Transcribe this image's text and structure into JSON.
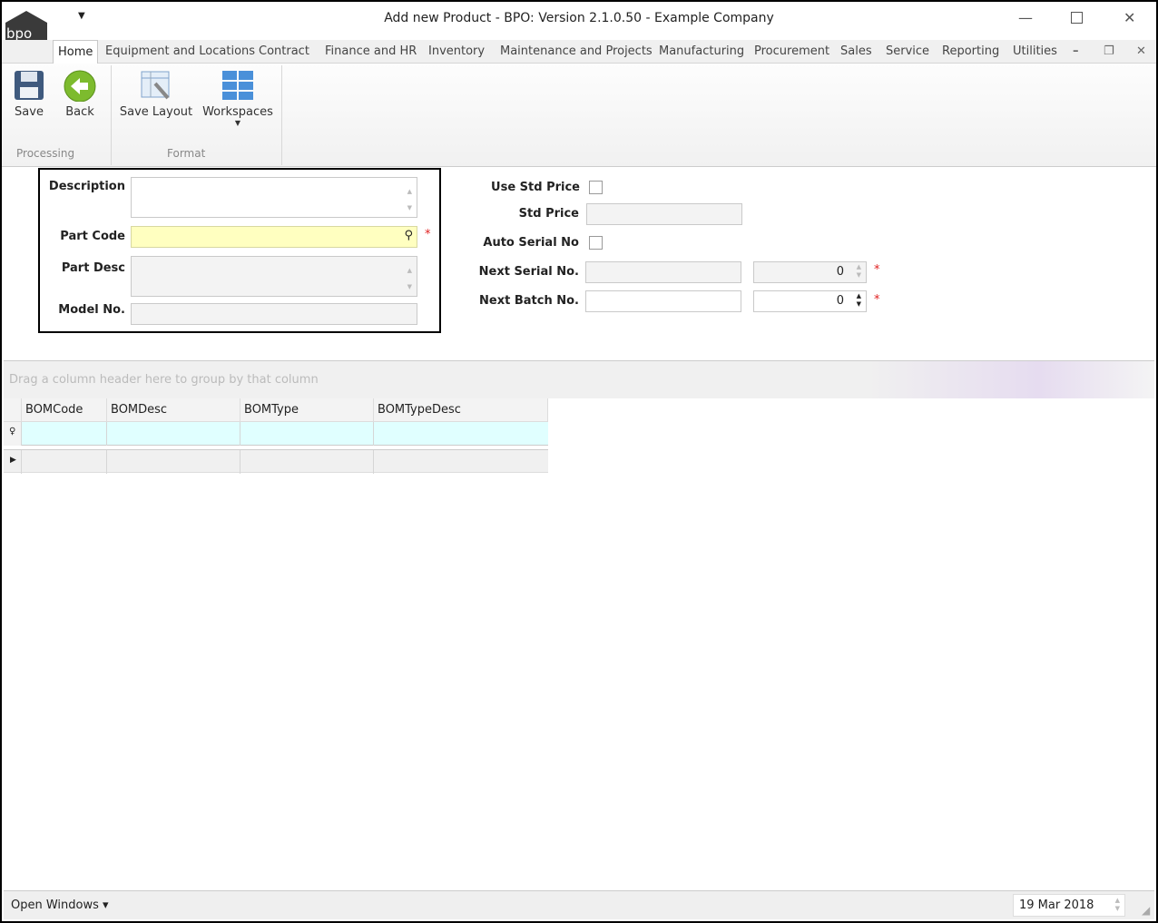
{
  "window": {
    "title": "Add new Product - BPO: Version 2.1.0.50 - Example Company",
    "logo_text": "bpo"
  },
  "tabs": [
    "Home",
    "Equipment and Locations",
    "Contract",
    "Finance and HR",
    "Inventory",
    "Maintenance and Projects",
    "Manufacturing",
    "Procurement",
    "Sales",
    "Service",
    "Reporting",
    "Utilities"
  ],
  "ribbon": {
    "save": "Save",
    "back": "Back",
    "save_layout": "Save Layout",
    "workspaces": "Workspaces",
    "group_processing": "Processing",
    "group_format": "Format"
  },
  "form": {
    "description": "Description",
    "part_code": "Part Code",
    "part_desc": "Part Desc",
    "model_no": "Model No.",
    "use_std_price": "Use Std Price",
    "std_price": "Std Price",
    "auto_serial_no": "Auto Serial No",
    "next_serial_no": "Next Serial No.",
    "next_batch_no": "Next Batch No.",
    "next_serial_value": "0",
    "next_batch_value": "0",
    "required": "*"
  },
  "grid": {
    "group_hint": "Drag a column header here to group by that column",
    "columns": [
      "BOMCode",
      "BOMDesc",
      "BOMType",
      "BOMTypeDesc"
    ]
  },
  "status": {
    "open_windows": "Open Windows ▾",
    "date": "19 Mar 2018"
  }
}
